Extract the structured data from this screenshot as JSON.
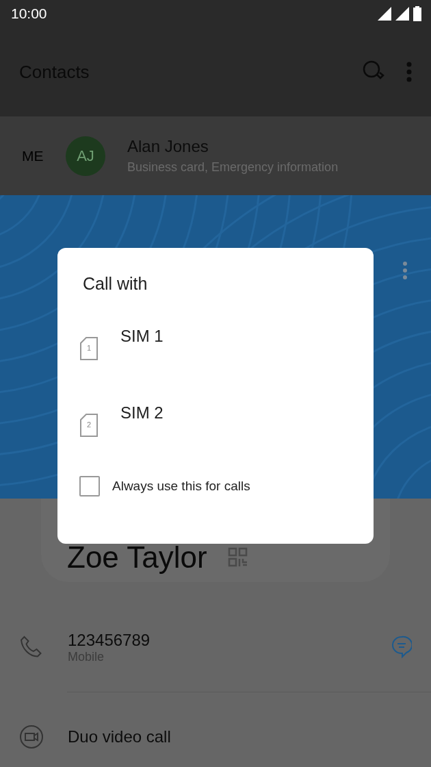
{
  "status_bar": {
    "time": "10:00"
  },
  "app_bar": {
    "title": "Contacts"
  },
  "me_row": {
    "label": "ME",
    "initials": "AJ",
    "name": "Alan Jones",
    "subtitle": "Business card, Emergency information"
  },
  "contact": {
    "name": "Zoe Taylor",
    "phone": {
      "number": "123456789",
      "type": "Mobile"
    },
    "video_label": "Duo video call"
  },
  "dialog": {
    "title": "Call with",
    "options": [
      {
        "label": "SIM 1",
        "slot": "1"
      },
      {
        "label": "SIM 2",
        "slot": "2"
      }
    ],
    "remember": {
      "label": "Always use this for calls",
      "checked": false
    }
  }
}
